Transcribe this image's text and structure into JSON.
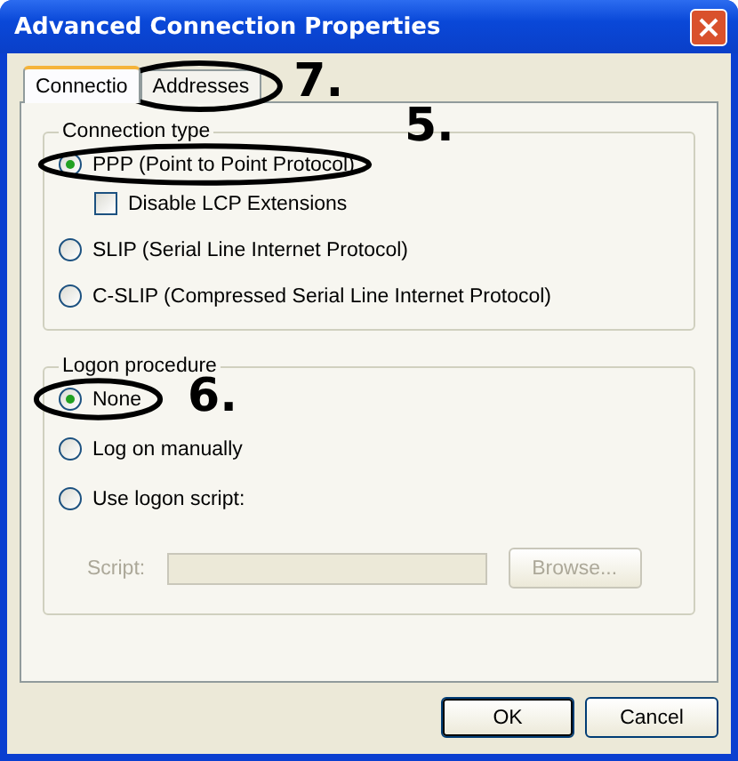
{
  "window": {
    "title": "Advanced Connection Properties"
  },
  "tabs": [
    {
      "label": "Connectio",
      "selected": true,
      "circled": false
    },
    {
      "label": "Addresses",
      "selected": false,
      "circled": true,
      "note": "7."
    }
  ],
  "connection_type": {
    "legend": "Connection type",
    "options": [
      {
        "label": "PPP (Point to Point Protocol)",
        "selected": true,
        "circled": true,
        "note": "5.",
        "sub": {
          "label": "Disable LCP Extensions",
          "checked": false
        }
      },
      {
        "label": "SLIP (Serial Line Internet Protocol)",
        "selected": false,
        "circled": false
      },
      {
        "label": "C-SLIP (Compressed Serial Line Internet Protocol)",
        "selected": false,
        "circled": false
      }
    ]
  },
  "logon_procedure": {
    "legend": "Logon procedure",
    "options": [
      {
        "label": "None",
        "selected": true,
        "circled": true,
        "note": "6."
      },
      {
        "label": "Log on manually",
        "selected": false,
        "circled": false
      },
      {
        "label": "Use logon script:",
        "selected": false,
        "circled": false
      }
    ],
    "script": {
      "label": "Script:",
      "button": "Browse...",
      "disabled": true
    }
  },
  "buttons": [
    {
      "label": "OK",
      "default": true
    },
    {
      "label": "Cancel",
      "default": false
    }
  ]
}
